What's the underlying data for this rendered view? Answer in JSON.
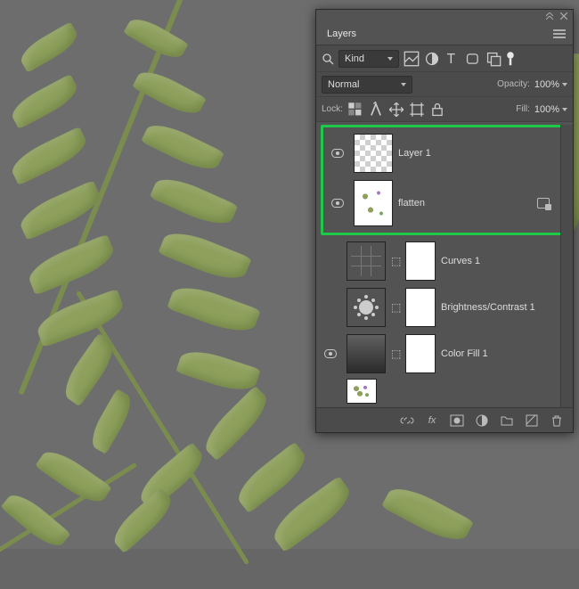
{
  "panel": {
    "title": "Layers",
    "filter": {
      "label": "Kind"
    },
    "blend_mode": "Normal",
    "opacity_label": "Opacity:",
    "opacity_value": "100%",
    "lock_label": "Lock:",
    "fill_label": "Fill:",
    "fill_value": "100%",
    "layers": [
      {
        "name": "Layer 1",
        "visible": true
      },
      {
        "name": "flatten",
        "visible": true
      },
      {
        "name": "Curves 1",
        "visible": false
      },
      {
        "name": "Brightness/Contrast 1",
        "visible": false
      },
      {
        "name": "Color Fill 1",
        "visible": true
      }
    ]
  },
  "icons": {
    "search": "search-icon",
    "image_filter": "image-filter-icon",
    "adjust_filter": "adjustment-filter-icon",
    "type_filter": "type-filter-icon",
    "shape_filter": "shape-filter-icon",
    "smart_filter": "smart-object-filter-icon",
    "artboard_filter": "artboard-filter-icon",
    "lock_transparent": "lock-transparent-icon",
    "lock_brush": "lock-image-icon",
    "lock_move": "lock-position-icon",
    "lock_artboard": "lock-artboard-icon",
    "lock_all": "lock-all-icon",
    "link": "link-icon",
    "fx": "fx-icon",
    "mask": "add-mask-icon",
    "adjustment": "new-adjustment-icon",
    "group": "new-group-icon",
    "new_layer": "new-layer-icon",
    "trash": "delete-icon"
  }
}
